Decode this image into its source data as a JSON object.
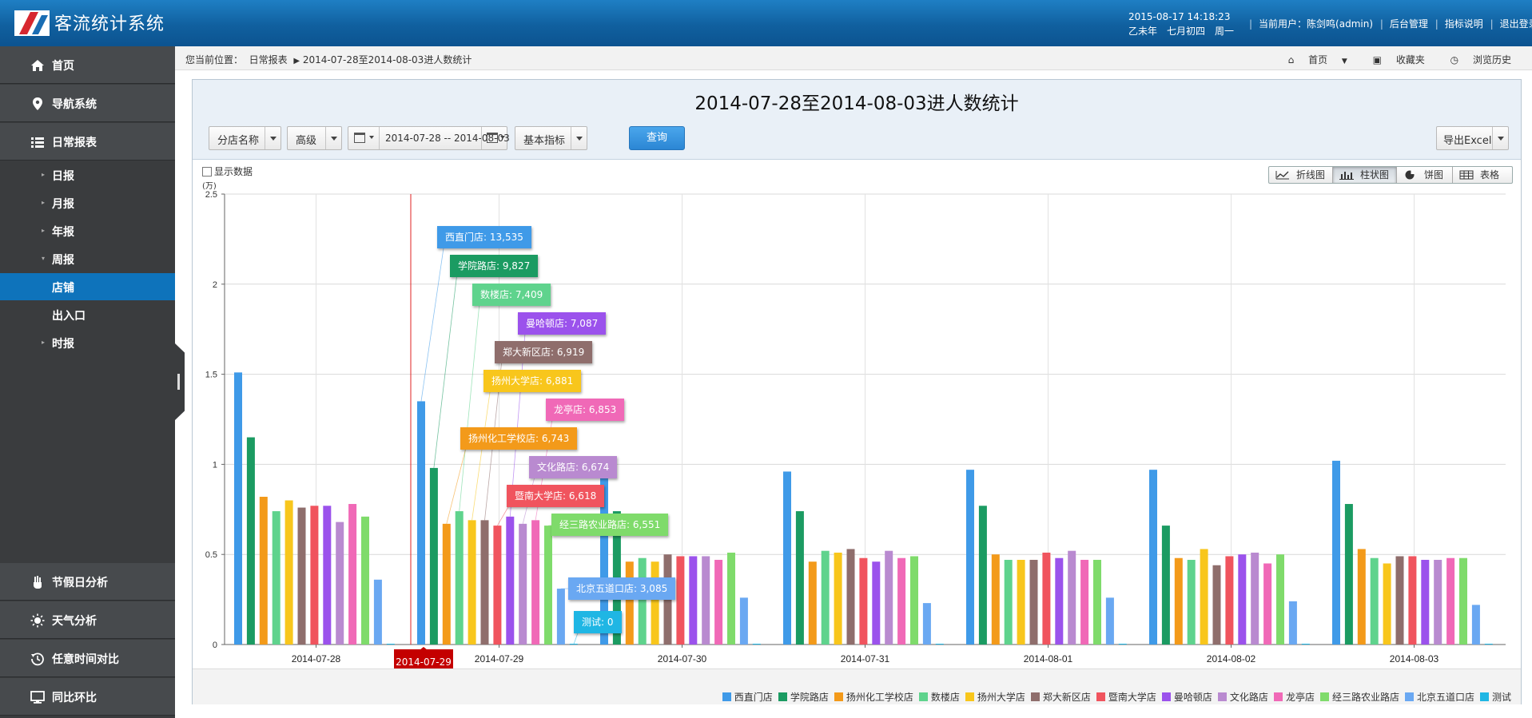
{
  "app": {
    "title": "客流统计系统"
  },
  "header": {
    "datetime": "2015-08-17 14:18:23",
    "lunar": "乙未年　七月初四　周一",
    "current_user": "当前用户：陈剑鸣(admin)",
    "admin_link": "后台管理",
    "help_link": "指标说明",
    "logout_link": "退出登录"
  },
  "sidebar": {
    "top_items": [
      {
        "label": "首页",
        "icon": "home-icon"
      },
      {
        "label": "导航系统",
        "icon": "location-pin-icon"
      },
      {
        "label": "日常报表",
        "icon": "list-icon"
      }
    ],
    "sub_items": [
      {
        "label": "日报",
        "caret": "▸"
      },
      {
        "label": "月报",
        "caret": "▸"
      },
      {
        "label": "年报",
        "caret": "▸"
      },
      {
        "label": "周报",
        "caret": "▾"
      },
      {
        "label": "店铺",
        "caret": ""
      },
      {
        "label": "出入口",
        "caret": ""
      },
      {
        "label": "时报",
        "caret": "▸"
      }
    ],
    "bottom_items": [
      {
        "label": "节假日分析",
        "icon": "hand-icon"
      },
      {
        "label": "天气分析",
        "icon": "sun-icon"
      },
      {
        "label": "任意时间对比",
        "icon": "history-icon"
      },
      {
        "label": "同比环比",
        "icon": "monitor-icon"
      }
    ]
  },
  "breadcrumb": {
    "prefix": "您当前位置：",
    "section": "日常报表",
    "arrow": "▶",
    "page": "2014-07-28至2014-08-03进人数统计",
    "home": "首页",
    "favorites": "收藏夹",
    "history": "浏览历史"
  },
  "toolbar": {
    "branch": "分店名称",
    "advanced": "高级",
    "date_range": "2014-07-28  --  2014-08-03",
    "metric": "基本指标",
    "query": "查询",
    "export": "导出Excel",
    "show_data": "显示数据",
    "chart_tabs": [
      "折线图",
      "柱状图",
      "饼图",
      "表格"
    ]
  },
  "report_title": "2014-07-28至2014-08-03进人数统计",
  "chart_data": {
    "type": "bar",
    "title": "2014-07-28至2014-08-03进人数统计",
    "ylabel": "(万)",
    "ylim": [
      0,
      2.5
    ],
    "yticks": [
      "0",
      "0.5",
      "1",
      "1.5",
      "2",
      "2.5"
    ],
    "grid": true,
    "legend_position": "bottom-right",
    "categories": [
      "2014-07-28",
      "2014-07-29",
      "2014-07-30",
      "2014-07-31",
      "2014-08-01",
      "2014-08-02",
      "2014-08-03"
    ],
    "series": [
      {
        "name": "西直门店",
        "color": "#3f9ae8",
        "values": [
          1.51,
          1.35,
          0.93,
          0.96,
          0.97,
          0.97,
          1.02
        ]
      },
      {
        "name": "学院路店",
        "color": "#1b9b62",
        "values": [
          1.15,
          0.98,
          0.74,
          0.74,
          0.77,
          0.66,
          0.78
        ]
      },
      {
        "name": "扬州化工学校店",
        "color": "#f39a1a",
        "values": [
          0.82,
          0.67,
          0.46,
          0.46,
          0.5,
          0.48,
          0.53
        ]
      },
      {
        "name": "数楼店",
        "color": "#5fd38d",
        "values": [
          0.74,
          0.74,
          0.48,
          0.52,
          0.47,
          0.47,
          0.48
        ]
      },
      {
        "name": "扬州大学店",
        "color": "#f8c61c",
        "values": [
          0.8,
          0.69,
          0.46,
          0.51,
          0.47,
          0.53,
          0.45
        ]
      },
      {
        "name": "郑大新区店",
        "color": "#8f6e6c",
        "values": [
          0.76,
          0.69,
          0.5,
          0.53,
          0.47,
          0.44,
          0.49
        ]
      },
      {
        "name": "暨南大学店",
        "color": "#f0545e",
        "values": [
          0.77,
          0.66,
          0.49,
          0.48,
          0.51,
          0.49,
          0.49
        ]
      },
      {
        "name": "曼哈顿店",
        "color": "#9b52ec",
        "values": [
          0.77,
          0.71,
          0.49,
          0.46,
          0.48,
          0.5,
          0.47
        ]
      },
      {
        "name": "文化路店",
        "color": "#b98ad0",
        "values": [
          0.68,
          0.67,
          0.49,
          0.52,
          0.52,
          0.51,
          0.47
        ]
      },
      {
        "name": "龙亭店",
        "color": "#f069b7",
        "values": [
          0.78,
          0.69,
          0.47,
          0.48,
          0.47,
          0.45,
          0.48
        ]
      },
      {
        "name": "经三路农业路店",
        "color": "#7fdb6b",
        "values": [
          0.71,
          0.66,
          0.51,
          0.49,
          0.47,
          0.5,
          0.48
        ]
      },
      {
        "name": "北京五道口店",
        "color": "#6aa8f2",
        "values": [
          0.36,
          0.31,
          0.26,
          0.23,
          0.26,
          0.24,
          0.22
        ]
      },
      {
        "name": "测试",
        "color": "#1fb6e4",
        "values": [
          0,
          0,
          0,
          0,
          0,
          0,
          0
        ]
      }
    ],
    "hover": {
      "category": "2014-07-29",
      "tooltips": [
        "西直门店: 13,535",
        "学院路店: 9,827",
        "数楼店: 7,409",
        "曼哈顿店: 7,087",
        "郑大新区店: 6,919",
        "扬州大学店: 6,881",
        "龙亭店: 6,853",
        "扬州化工学校店: 6,743",
        "文化路店: 6,674",
        "暨南大学店: 6,618",
        "经三路农业路店: 6,551",
        "北京五道口店: 3,085",
        "测试: 0"
      ],
      "tooltip_colors": [
        "#3f9ae8",
        "#1b9b62",
        "#5fd38d",
        "#9b52ec",
        "#8f6e6c",
        "#f8c61c",
        "#f069b7",
        "#f39a1a",
        "#b98ad0",
        "#f0545e",
        "#7fdb6b",
        "#6aa8f2",
        "#1fb6e4"
      ]
    }
  }
}
